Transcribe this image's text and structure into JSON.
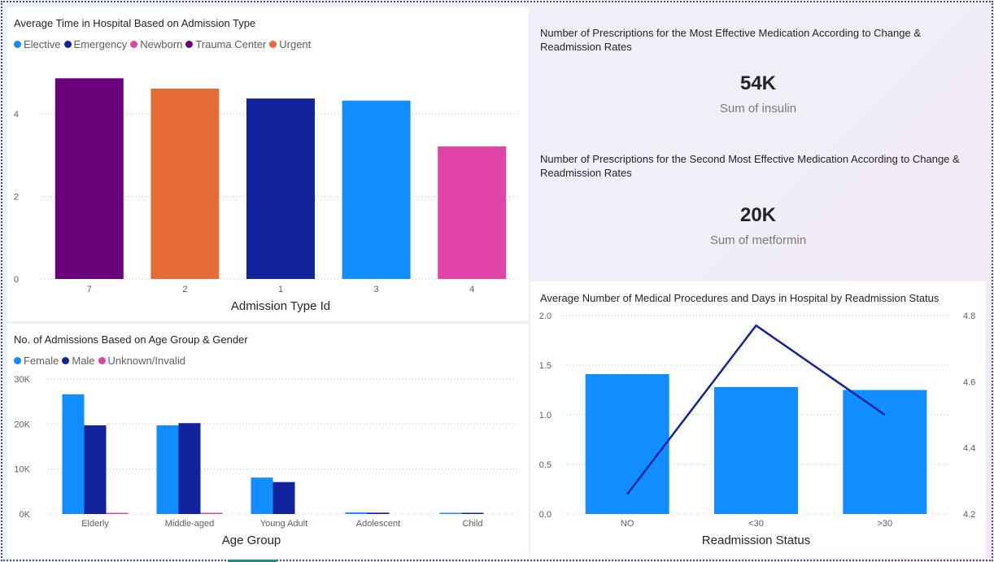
{
  "colors": {
    "elective": "#118dff",
    "emergency": "#12239e",
    "newborn": "#e044a7",
    "trauma_center": "#6b007b",
    "urgent": "#e66c37",
    "female": "#118dff",
    "male": "#12239e",
    "unknown": "#e044a7",
    "line": "#12239e"
  },
  "charts": {
    "admission": {
      "title": "Average Time in Hospital Based on Admission Type",
      "legend": [
        {
          "label": "Elective",
          "color_key": "elective"
        },
        {
          "label": "Emergency",
          "color_key": "emergency"
        },
        {
          "label": "Newborn",
          "color_key": "newborn"
        },
        {
          "label": "Trauma Center",
          "color_key": "trauma_center"
        },
        {
          "label": "Urgent",
          "color_key": "urgent"
        }
      ],
      "xlabel": "Admission Type Id"
    },
    "age_gender": {
      "title": "No. of Admissions Based on Age Group & Gender",
      "legend": [
        {
          "label": "Female",
          "color_key": "female"
        },
        {
          "label": "Male",
          "color_key": "male"
        },
        {
          "label": "Unknown/Invalid",
          "color_key": "unknown"
        }
      ],
      "xlabel": "Age Group"
    },
    "readmission": {
      "title": "Average Number of Medical Procedures and Days in Hospital by Readmission Status",
      "xlabel": "Readmission Status"
    }
  },
  "kpis": [
    {
      "title": "Number of Prescriptions for the Most Effective Medication According to Change & Readmission Rates",
      "value": "54K",
      "label": "Sum of insulin"
    },
    {
      "title": "Number of Prescriptions for the Second Most Effective Medication According to Change & Readmission Rates",
      "value": "20K",
      "label": "Sum of metformin"
    }
  ],
  "chart_data": [
    {
      "type": "bar",
      "title": "Average Time in Hospital Based on Admission Type",
      "categories": [
        "7",
        "2",
        "1",
        "3",
        "4"
      ],
      "values": [
        4.86,
        4.61,
        4.37,
        4.32,
        3.21
      ],
      "bar_color_keys": [
        "trauma_center",
        "urgent",
        "emergency",
        "elective",
        "newborn"
      ],
      "xlabel": "Admission Type Id",
      "ylabel": "",
      "yticks": [
        "0",
        "2",
        "4"
      ],
      "ylim": [
        0,
        5.2
      ],
      "grid": true,
      "legend": "top-left"
    },
    {
      "type": "bar",
      "title": "No. of Admissions Based on Age Group & Gender",
      "categories": [
        "Elderly",
        "Middle-aged",
        "Young Adult",
        "Adolescent",
        "Child"
      ],
      "series": [
        {
          "name": "Female",
          "color_key": "female",
          "values": [
            26600,
            19700,
            8100,
            350,
            150
          ]
        },
        {
          "name": "Male",
          "color_key": "male",
          "values": [
            19700,
            20200,
            7100,
            300,
            150
          ]
        },
        {
          "name": "Unknown/Invalid",
          "color_key": "unknown",
          "values": [
            150,
            150,
            0,
            0,
            0
          ]
        }
      ],
      "xlabel": "Age Group",
      "ylabel": "",
      "yticks": [
        "0K",
        "10K",
        "20K",
        "30K"
      ],
      "ylim": [
        0,
        30000
      ],
      "grid": true,
      "legend": "top-left"
    },
    {
      "type": "bar",
      "title": "Average Number of Medical Procedures and Days in Hospital by Readmission Status",
      "categories": [
        "NO",
        "<30",
        ">30"
      ],
      "series": [
        {
          "color_key": "elective",
          "axis": "left",
          "kind": "bar",
          "values": [
            1.41,
            1.28,
            1.25
          ]
        },
        {
          "color_key": "line",
          "axis": "right",
          "kind": "line",
          "values": [
            4.26,
            4.77,
            4.5
          ]
        }
      ],
      "xlabel": "Readmission Status",
      "yticks_left": [
        "0.0",
        "0.5",
        "1.0",
        "1.5",
        "2.0"
      ],
      "ylim_left": [
        0,
        2.0
      ],
      "yticks_right": [
        "4.2",
        "4.4",
        "4.6",
        "4.8"
      ],
      "ylim_right": [
        4.2,
        4.8
      ],
      "grid": true
    }
  ]
}
